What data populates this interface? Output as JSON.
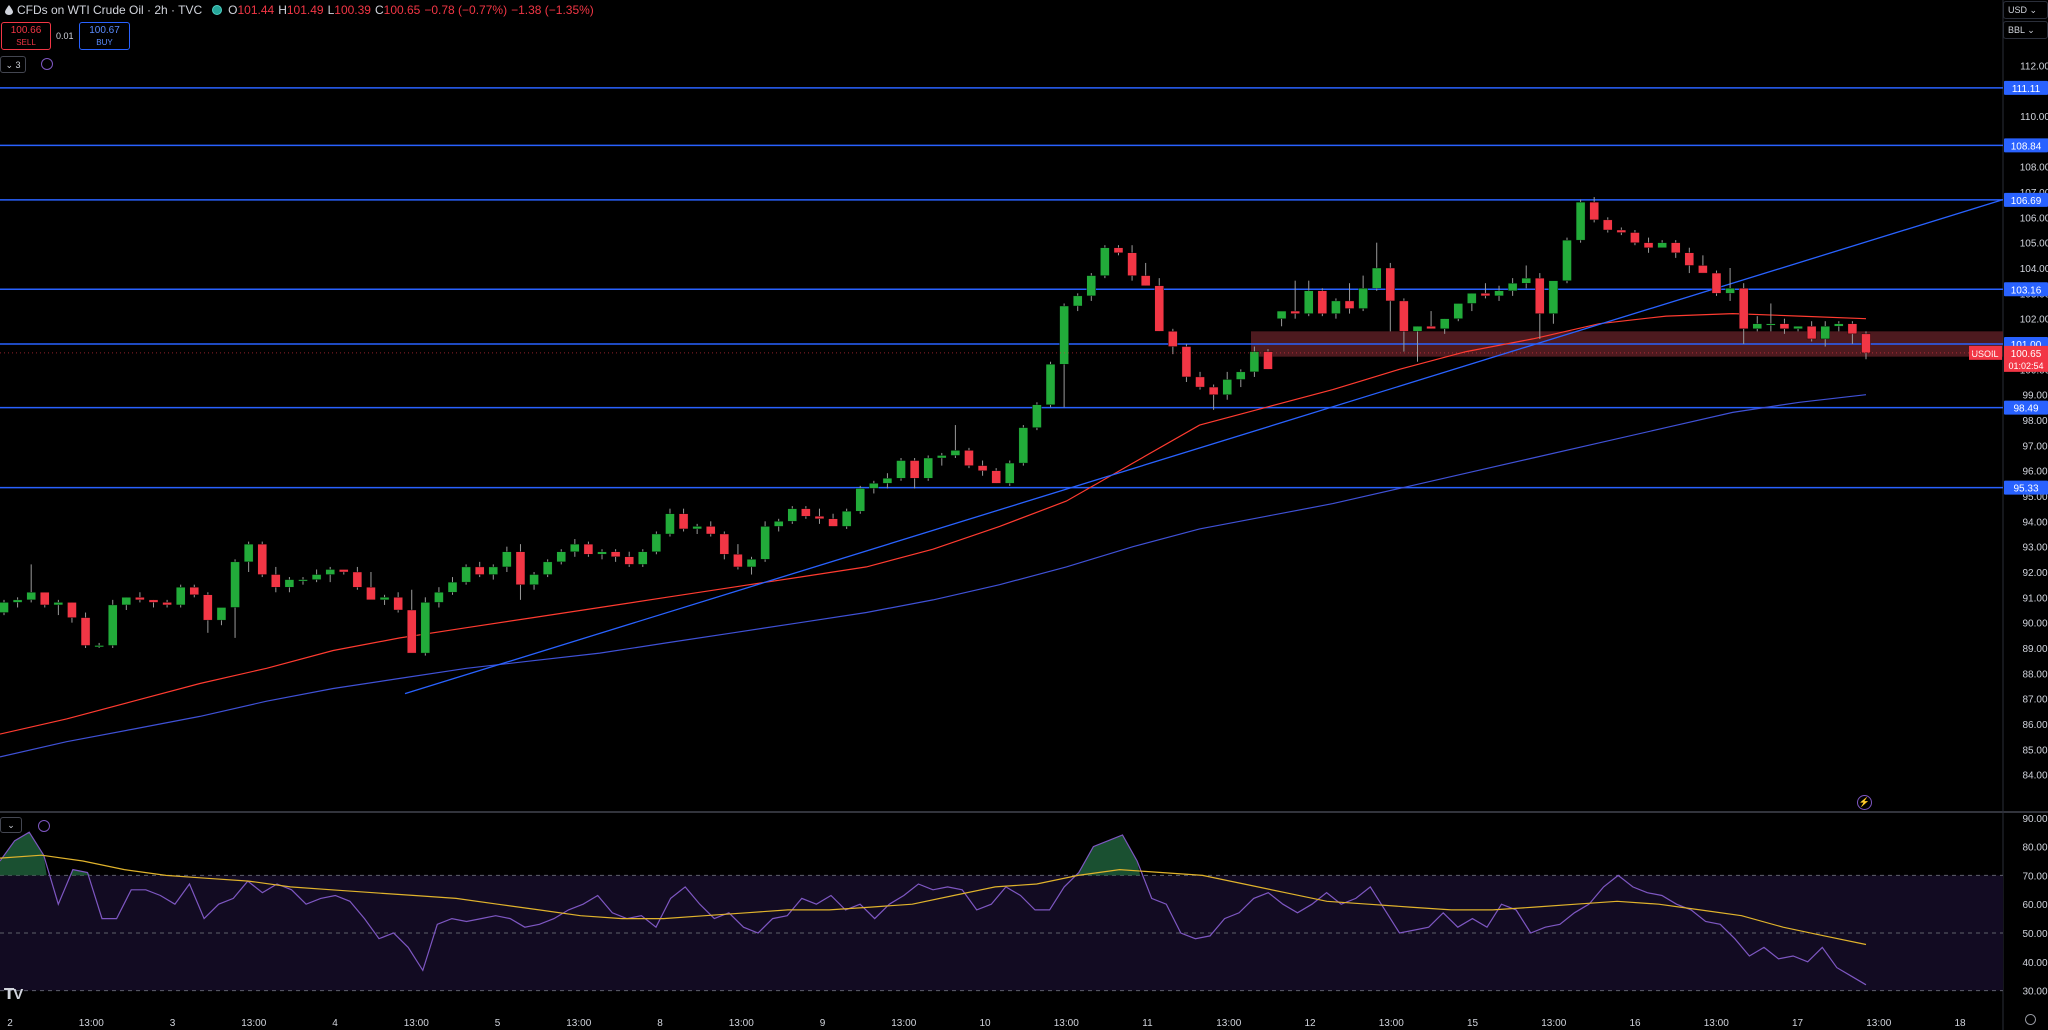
{
  "header": {
    "symbol": "CFDs on WTI Crude Oil · 2h · TVC",
    "open_label": "O",
    "open": "101.44",
    "high_label": "H",
    "high": "101.49",
    "low_label": "L",
    "low": "100.39",
    "close_label": "C",
    "close": "100.65",
    "change": "−0.78 (−0.77%)",
    "change2": "−1.38 (−1.35%)"
  },
  "trade": {
    "sell_price": "100.66",
    "sell_label": "SELL",
    "spread": "0.01",
    "buy_price": "100.67",
    "buy_label": "BUY"
  },
  "toolbar": {
    "collapse_count": "3"
  },
  "top_right": {
    "currency": "USD",
    "unit": "BBL"
  },
  "colors": {
    "up": "#26a69a",
    "up_candle": "#22ab3a",
    "down": "#f23645",
    "hline": "#2962ff",
    "ma_fast": "#ff3b30",
    "ma_slow": "#3f51d6",
    "rsi": "#7e57c2",
    "rsi_ma": "#e0b32c",
    "zone": "#5a1f24"
  },
  "chart_data": {
    "type": "candlestick",
    "price_axis": {
      "ticks": [
        "112.00",
        "111.00",
        "110.00",
        "109.00",
        "108.00",
        "107.00",
        "106.00",
        "105.00",
        "104.00",
        "103.00",
        "102.00",
        "101.00",
        "100.00",
        "99.00",
        "98.00",
        "97.00",
        "96.00",
        "95.00",
        "94.00",
        "93.00",
        "92.00",
        "91.00",
        "90.00",
        "89.00",
        "88.00",
        "87.00",
        "86.00",
        "85.00",
        "84.00"
      ],
      "range": [
        83.0,
        113.0
      ]
    },
    "time_axis": {
      "labels": [
        "2",
        "13:00",
        "3",
        "13:00",
        "4",
        "13:00",
        "5",
        "13:00",
        "8",
        "13:00",
        "9",
        "13:00",
        "10",
        "13:00",
        "11",
        "13:00",
        "12",
        "13:00",
        "15",
        "13:00",
        "16",
        "13:00",
        "17",
        "13:00",
        "18"
      ]
    },
    "horizontal_levels": [
      111.11,
      108.84,
      106.69,
      103.16,
      101.0,
      98.49,
      95.33
    ],
    "price_badges": [
      {
        "value": "111.11",
        "kind": "level"
      },
      {
        "value": "108.84",
        "kind": "level"
      },
      {
        "value": "106.69",
        "kind": "level"
      },
      {
        "value": "103.16",
        "kind": "level"
      },
      {
        "value": "101.00",
        "kind": "level"
      },
      {
        "value": "98.49",
        "kind": "level"
      },
      {
        "value": "95.33",
        "kind": "level"
      }
    ],
    "last_price": {
      "symbol": "USOIL",
      "value": "100.65",
      "countdown": "01:02:54"
    },
    "resistance_zone": {
      "from": 100.5,
      "to": 101.5
    },
    "trendline": {
      "from": 87.2,
      "to": 106.7
    },
    "candles": [
      [
        90.4,
        90.9,
        90.3,
        90.8
      ],
      [
        90.8,
        91.0,
        90.6,
        90.9
      ],
      [
        90.9,
        92.3,
        90.8,
        91.2
      ],
      [
        91.2,
        91.2,
        90.6,
        90.7
      ],
      [
        90.7,
        90.9,
        90.3,
        90.8
      ],
      [
        90.8,
        90.8,
        90.0,
        90.2
      ],
      [
        90.2,
        90.4,
        89.0,
        89.1
      ],
      [
        89.1,
        89.2,
        89.0,
        89.1
      ],
      [
        89.1,
        90.9,
        89.0,
        90.7
      ],
      [
        90.7,
        91.0,
        90.5,
        91.0
      ],
      [
        91.0,
        91.2,
        90.8,
        90.9
      ],
      [
        90.9,
        90.9,
        90.6,
        90.8
      ],
      [
        90.8,
        90.9,
        90.6,
        90.7
      ],
      [
        90.7,
        91.5,
        90.6,
        91.4
      ],
      [
        91.4,
        91.5,
        91.0,
        91.1
      ],
      [
        91.1,
        91.2,
        89.6,
        90.1
      ],
      [
        90.1,
        90.5,
        89.9,
        90.6
      ],
      [
        90.6,
        92.5,
        89.4,
        92.4
      ],
      [
        92.4,
        93.2,
        92.0,
        93.1
      ],
      [
        93.1,
        93.2,
        91.8,
        91.9
      ],
      [
        91.9,
        92.2,
        91.2,
        91.4
      ],
      [
        91.4,
        91.8,
        91.2,
        91.7
      ],
      [
        91.7,
        91.8,
        91.5,
        91.7
      ],
      [
        91.7,
        92.1,
        91.6,
        91.9
      ],
      [
        91.9,
        92.2,
        91.6,
        92.1
      ],
      [
        92.1,
        92.1,
        91.9,
        92.0
      ],
      [
        92.0,
        92.2,
        91.3,
        91.4
      ],
      [
        91.4,
        92.0,
        91.0,
        90.9
      ],
      [
        90.9,
        91.1,
        90.7,
        91.0
      ],
      [
        91.0,
        91.2,
        90.4,
        90.5
      ],
      [
        90.5,
        91.3,
        89.0,
        88.8
      ],
      [
        88.8,
        91.0,
        88.7,
        90.8
      ],
      [
        90.8,
        91.4,
        90.6,
        91.2
      ],
      [
        91.2,
        91.8,
        91.1,
        91.6
      ],
      [
        91.6,
        92.3,
        91.5,
        92.2
      ],
      [
        92.2,
        92.4,
        91.8,
        91.9
      ],
      [
        91.9,
        92.3,
        91.7,
        92.2
      ],
      [
        92.2,
        93.0,
        92.0,
        92.8
      ],
      [
        92.8,
        93.1,
        90.9,
        91.5
      ],
      [
        91.5,
        92.0,
        91.3,
        91.9
      ],
      [
        91.9,
        92.5,
        91.8,
        92.4
      ],
      [
        92.4,
        92.9,
        92.3,
        92.8
      ],
      [
        92.8,
        93.3,
        92.6,
        93.1
      ],
      [
        93.1,
        93.2,
        92.6,
        92.7
      ],
      [
        92.7,
        92.9,
        92.5,
        92.8
      ],
      [
        92.8,
        92.9,
        92.4,
        92.6
      ],
      [
        92.6,
        92.8,
        92.2,
        92.3
      ],
      [
        92.3,
        92.9,
        92.2,
        92.8
      ],
      [
        92.8,
        93.6,
        92.7,
        93.5
      ],
      [
        93.5,
        94.5,
        93.4,
        94.3
      ],
      [
        94.3,
        94.5,
        93.6,
        93.7
      ],
      [
        93.7,
        93.9,
        93.5,
        93.8
      ],
      [
        93.8,
        94.0,
        93.4,
        93.5
      ],
      [
        93.5,
        93.6,
        92.5,
        92.7
      ],
      [
        92.7,
        93.1,
        92.1,
        92.2
      ],
      [
        92.2,
        92.6,
        91.9,
        92.5
      ],
      [
        92.5,
        94.0,
        92.4,
        93.8
      ],
      [
        93.8,
        94.1,
        93.6,
        94.0
      ],
      [
        94.0,
        94.6,
        93.9,
        94.5
      ],
      [
        94.5,
        94.6,
        94.1,
        94.2
      ],
      [
        94.2,
        94.5,
        93.9,
        94.1
      ],
      [
        94.1,
        94.3,
        93.8,
        93.8
      ],
      [
        93.8,
        94.5,
        93.7,
        94.4
      ],
      [
        94.4,
        95.4,
        94.3,
        95.3
      ],
      [
        95.3,
        95.6,
        95.1,
        95.5
      ],
      [
        95.5,
        95.9,
        95.3,
        95.7
      ],
      [
        95.7,
        96.5,
        95.6,
        96.4
      ],
      [
        96.4,
        96.5,
        95.3,
        95.7
      ],
      [
        95.7,
        96.6,
        95.6,
        96.5
      ],
      [
        96.5,
        96.7,
        96.2,
        96.6
      ],
      [
        96.6,
        97.8,
        96.5,
        96.8
      ],
      [
        96.8,
        96.9,
        96.1,
        96.2
      ],
      [
        96.2,
        96.4,
        95.8,
        96.0
      ],
      [
        96.0,
        96.1,
        95.5,
        95.5
      ],
      [
        95.5,
        96.4,
        95.4,
        96.3
      ],
      [
        96.3,
        97.8,
        96.2,
        97.7
      ],
      [
        97.7,
        98.7,
        97.6,
        98.6
      ],
      [
        98.6,
        100.3,
        98.5,
        100.2
      ],
      [
        100.2,
        102.6,
        98.5,
        102.5
      ],
      [
        102.5,
        103.0,
        102.3,
        102.9
      ],
      [
        102.9,
        103.8,
        102.7,
        103.7
      ],
      [
        103.7,
        104.9,
        103.6,
        104.8
      ],
      [
        104.8,
        104.9,
        104.5,
        104.6
      ],
      [
        104.6,
        104.9,
        103.5,
        103.7
      ],
      [
        103.7,
        104.2,
        103.3,
        103.3
      ],
      [
        103.3,
        103.6,
        101.5,
        101.5
      ],
      [
        101.5,
        101.6,
        100.6,
        100.9
      ],
      [
        100.9,
        101.0,
        99.5,
        99.7
      ],
      [
        99.7,
        99.9,
        99.2,
        99.3
      ],
      [
        99.3,
        99.4,
        98.4,
        99.0
      ],
      [
        99.0,
        99.9,
        98.8,
        99.6
      ],
      [
        99.6,
        100.0,
        99.3,
        99.9
      ],
      [
        99.9,
        100.9,
        99.7,
        100.7
      ],
      [
        100.7,
        100.8,
        100.0,
        100.0
      ],
      [
        102.0,
        102.2,
        101.7,
        102.3
      ],
      [
        102.3,
        103.5,
        102.0,
        102.2
      ],
      [
        102.2,
        103.5,
        102.1,
        103.1
      ],
      [
        103.1,
        103.2,
        102.1,
        102.2
      ],
      [
        102.2,
        102.8,
        102.0,
        102.7
      ],
      [
        102.7,
        103.4,
        102.2,
        102.4
      ],
      [
        102.4,
        103.7,
        102.3,
        103.2
      ],
      [
        103.2,
        105.0,
        103.1,
        104.0
      ],
      [
        104.0,
        104.2,
        101.5,
        102.7
      ],
      [
        102.7,
        102.8,
        100.7,
        101.5
      ],
      [
        101.5,
        101.7,
        100.3,
        101.7
      ],
      [
        101.7,
        102.3,
        101.6,
        101.6
      ],
      [
        101.6,
        102.0,
        101.4,
        102.0
      ],
      [
        102.0,
        102.6,
        101.9,
        102.6
      ],
      [
        102.6,
        103.0,
        102.3,
        103.0
      ],
      [
        103.0,
        103.4,
        102.8,
        102.9
      ],
      [
        102.9,
        103.3,
        102.7,
        103.1
      ],
      [
        103.1,
        103.6,
        102.9,
        103.4
      ],
      [
        103.4,
        104.1,
        103.2,
        103.6
      ],
      [
        103.6,
        103.8,
        101.2,
        102.2
      ],
      [
        102.2,
        103.4,
        101.8,
        103.5
      ],
      [
        103.5,
        105.2,
        103.4,
        105.1
      ],
      [
        105.1,
        106.7,
        105.0,
        106.6
      ],
      [
        106.6,
        106.8,
        105.8,
        105.9
      ],
      [
        105.9,
        106.0,
        105.4,
        105.5
      ],
      [
        105.5,
        105.6,
        105.3,
        105.4
      ],
      [
        105.4,
        105.5,
        104.9,
        105.0
      ],
      [
        105.0,
        105.2,
        104.6,
        104.8
      ],
      [
        104.8,
        105.1,
        104.8,
        105.0
      ],
      [
        105.0,
        105.1,
        104.4,
        104.6
      ],
      [
        104.6,
        104.8,
        103.8,
        104.1
      ],
      [
        104.1,
        104.5,
        103.8,
        103.8
      ],
      [
        103.8,
        103.9,
        102.9,
        103.0
      ],
      [
        103.0,
        104.0,
        102.7,
        103.2
      ],
      [
        103.2,
        103.4,
        101.0,
        101.6
      ],
      [
        101.6,
        102.1,
        101.5,
        101.8
      ],
      [
        101.8,
        102.6,
        101.5,
        101.8
      ],
      [
        101.8,
        102.0,
        101.4,
        101.6
      ],
      [
        101.6,
        101.7,
        101.5,
        101.7
      ],
      [
        101.7,
        101.9,
        101.1,
        101.2
      ],
      [
        101.2,
        101.9,
        100.9,
        101.7
      ],
      [
        101.7,
        101.9,
        101.5,
        101.8
      ],
      [
        101.8,
        101.9,
        101.0,
        101.4
      ],
      [
        101.4,
        101.5,
        100.4,
        100.65
      ]
    ],
    "ma_fast": [
      85.6,
      86.2,
      86.9,
      87.6,
      88.2,
      88.9,
      89.4,
      89.8,
      90.2,
      90.6,
      91.0,
      91.4,
      91.8,
      92.2,
      92.9,
      93.8,
      94.8,
      96.3,
      97.8,
      98.5,
      99.2,
      100.0,
      100.7,
      101.2,
      101.8,
      102.1,
      102.2,
      102.1,
      102.0
    ],
    "ma_slow": [
      84.7,
      85.3,
      85.8,
      86.3,
      86.9,
      87.4,
      87.8,
      88.2,
      88.5,
      88.8,
      89.2,
      89.6,
      90.0,
      90.4,
      90.9,
      91.5,
      92.2,
      93.0,
      93.7,
      94.2,
      94.7,
      95.3,
      95.9,
      96.5,
      97.1,
      97.7,
      98.3,
      98.7,
      99.0
    ],
    "rsi": {
      "axis_ticks": [
        "90.00",
        "80.00",
        "70.00",
        "60.00",
        "50.00",
        "40.00",
        "30.00"
      ],
      "range": [
        25,
        92
      ],
      "bands": [
        70,
        50,
        30
      ],
      "values": [
        75,
        82,
        85,
        77,
        60,
        72,
        71,
        55,
        55,
        65,
        65,
        63,
        60,
        67,
        55,
        60,
        62,
        68,
        64,
        67,
        65,
        60,
        62,
        63,
        61,
        55,
        48,
        50,
        45,
        37,
        53,
        55,
        54,
        55,
        56,
        55,
        52,
        53,
        55,
        58,
        60,
        63,
        57,
        55,
        56,
        52,
        62,
        66,
        60,
        55,
        57,
        52,
        50,
        55,
        56,
        62,
        60,
        63,
        58,
        60,
        55,
        60,
        63,
        67,
        65,
        66,
        65,
        58,
        60,
        66,
        63,
        58,
        58,
        66,
        71,
        80,
        82,
        84,
        75,
        62,
        60,
        50,
        48,
        49,
        55,
        57,
        62,
        64,
        60,
        57,
        60,
        64,
        60,
        62,
        66,
        58,
        50,
        51,
        52,
        57,
        52,
        55,
        52,
        60,
        58,
        50,
        52,
        53,
        57,
        60,
        66,
        70,
        66,
        64,
        63,
        60,
        58,
        54,
        53,
        48,
        42,
        45,
        41,
        42,
        40,
        45,
        38,
        35,
        32
      ],
      "ma": [
        76,
        77,
        75,
        72,
        70,
        69,
        68,
        66,
        65,
        64,
        63,
        62,
        60,
        58,
        56,
        55,
        55,
        56,
        57,
        58,
        58,
        59,
        60,
        63,
        66,
        67,
        70,
        72,
        71,
        70,
        67,
        64,
        61,
        60,
        59,
        58,
        58,
        59,
        60,
        61,
        60,
        58,
        56,
        52,
        49,
        46
      ]
    }
  }
}
